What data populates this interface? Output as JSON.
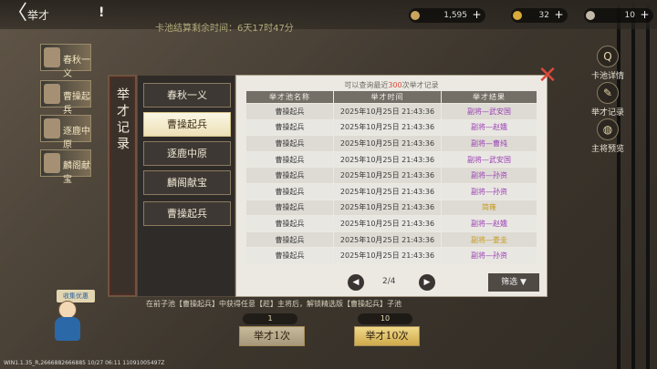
{
  "header": {
    "title": "举才",
    "back_label": "〈",
    "warn": "!"
  },
  "resources": [
    {
      "value": "1,595",
      "color": "#caa45c"
    },
    {
      "value": "32",
      "color": "#d9a93a"
    },
    {
      "value": "10",
      "color": "#c2b9a8"
    }
  ],
  "marquee": "卡池结算剩余时间：6天17时47分",
  "left_cards": [
    "春秋一义",
    "曹操起兵",
    "逐鹿中原",
    "麟阁献宝"
  ],
  "side_menu": [
    {
      "label": "卡池详情",
      "icon": "Q"
    },
    {
      "label": "举才记录",
      "icon": "✎"
    },
    {
      "label": "主将预览",
      "icon": "◍"
    }
  ],
  "panel": {
    "vertical_title": "举才记录",
    "tabs": [
      {
        "label": "春秋一义",
        "active": false
      },
      {
        "label": "曹操起兵",
        "active": true
      },
      {
        "label": "逐鹿中原",
        "active": false
      },
      {
        "label": "麟阁献宝",
        "active": false
      },
      {
        "label": "曹操起兵",
        "active": false
      }
    ],
    "hint_prefix": "可以查询最近",
    "hint_number": "300",
    "hint_suffix": "次举才记录",
    "columns": [
      "举才池名称",
      "举才时间",
      "举才结果"
    ],
    "rows": [
      {
        "pool": "曹操起兵",
        "time": "2025年10月25日 21:43:36",
        "result": "副将—武安国",
        "color": "#9a3fb4"
      },
      {
        "pool": "曹操起兵",
        "time": "2025年10月25日 21:43:36",
        "result": "副将—赵娥",
        "color": "#9a3fb4"
      },
      {
        "pool": "曹操起兵",
        "time": "2025年10月25日 21:43:36",
        "result": "副将—曹纯",
        "color": "#9a3fb4"
      },
      {
        "pool": "曹操起兵",
        "time": "2025年10月25日 21:43:36",
        "result": "副将—武安国",
        "color": "#9a3fb4"
      },
      {
        "pool": "曹操起兵",
        "time": "2025年10月25日 21:43:36",
        "result": "副将—孙资",
        "color": "#9a3fb4"
      },
      {
        "pool": "曹操起兵",
        "time": "2025年10月25日 21:43:36",
        "result": "副将—孙资",
        "color": "#9a3fb4"
      },
      {
        "pool": "曹操起兵",
        "time": "2025年10月25日 21:43:36",
        "result": "简雍",
        "color": "#c79a1e"
      },
      {
        "pool": "曹操起兵",
        "time": "2025年10月25日 21:43:36",
        "result": "副将—赵娥",
        "color": "#9a3fb4"
      },
      {
        "pool": "曹操起兵",
        "time": "2025年10月25日 21:43:36",
        "result": "副将—娄圭",
        "color": "#c79a1e"
      },
      {
        "pool": "曹操起兵",
        "time": "2025年10月25日 21:43:36",
        "result": "副将—孙资",
        "color": "#9a3fb4"
      }
    ],
    "page": "2/4",
    "filter_label": "筛选"
  },
  "bottom": {
    "ticker": "在前子池【曹操起兵】中获得任意【趁】主将后，解锁精选版【曹操起兵】子池",
    "cost_1": "1",
    "cost_10": "10",
    "draw_1": "举才1次",
    "draw_10": "举才10次",
    "banner": "收集优惠"
  },
  "footer": "WIN1.1.35_R,2666882666885 10/27 06:11 11091005497Z"
}
